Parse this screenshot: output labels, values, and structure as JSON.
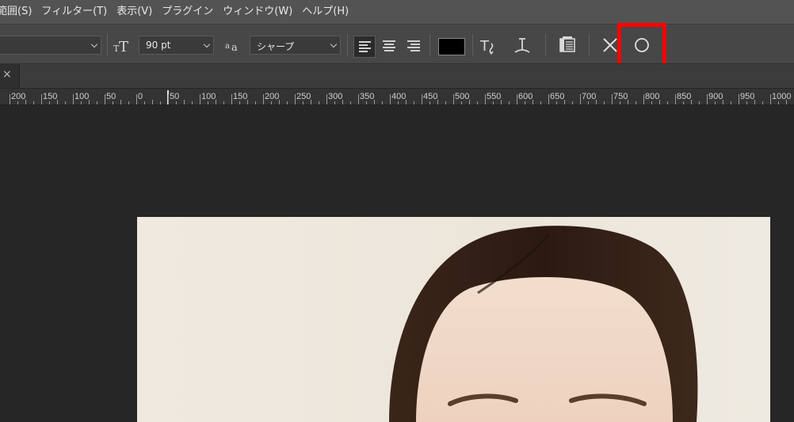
{
  "menubar": {
    "items": [
      "範囲(S)",
      "フィルター(T)",
      "表示(V)",
      "プラグイン",
      "ウィンドウ(W)",
      "ヘルプ(H)"
    ]
  },
  "options": {
    "font_size_value": "90 pt",
    "anti_alias_value": "シャープ",
    "text_color": "#000000"
  },
  "tab": {
    "close_glyph": "×"
  },
  "ruler": {
    "labels": [
      "200",
      "150",
      "100",
      "50",
      "0",
      "50",
      "100",
      "150",
      "200",
      "250",
      "300",
      "350",
      "400",
      "450",
      "500",
      "550",
      "600",
      "650",
      "700",
      "750",
      "800",
      "850",
      "900",
      "950",
      "1000"
    ]
  },
  "highlight": {
    "color": "#ff0000",
    "target": "commit-check-button"
  }
}
